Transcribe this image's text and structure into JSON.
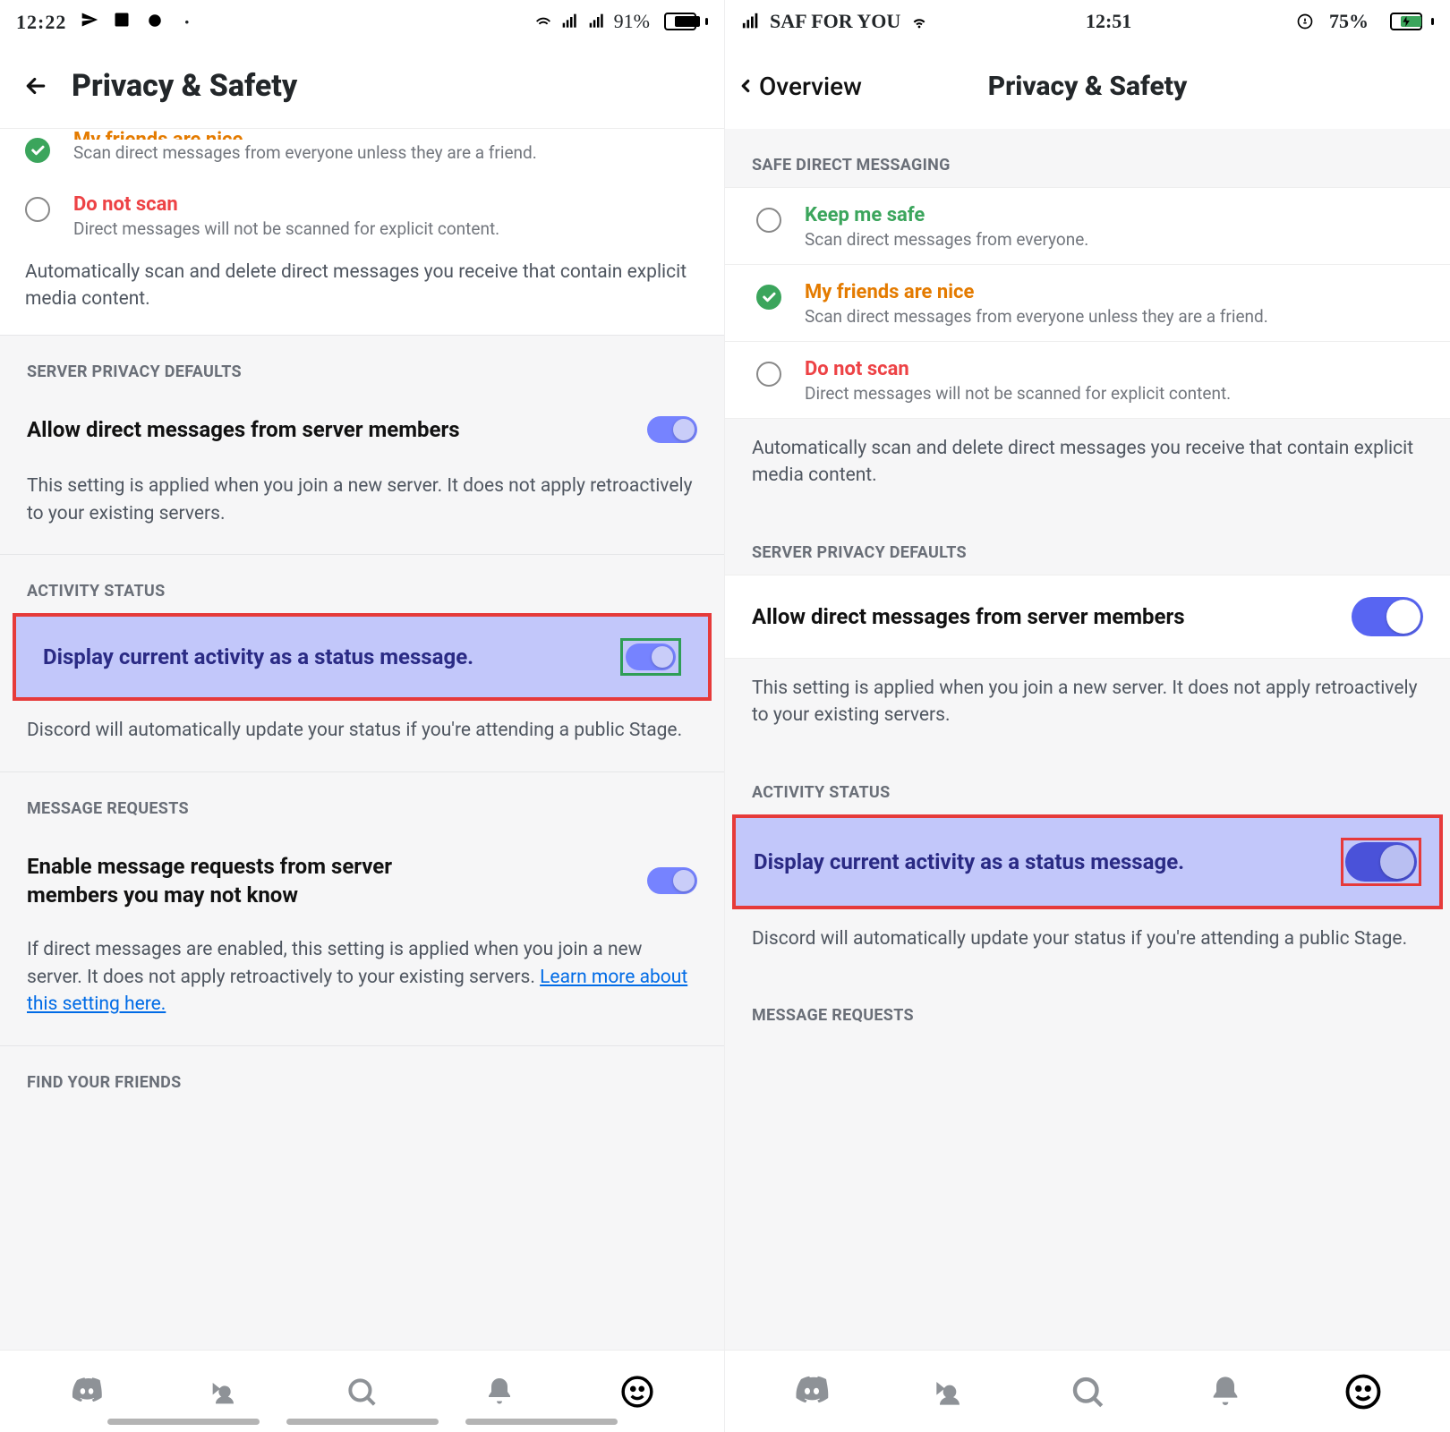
{
  "left": {
    "status": {
      "time": "12:22",
      "battery": "91%"
    },
    "title": "Privacy & Safety",
    "peek_friends": {
      "title": "My friends are nice",
      "sub": "Scan direct messages from everyone unless they are a friend."
    },
    "peek_noscan": {
      "title": "Do not scan",
      "sub": "Direct messages will not be scanned for explicit content."
    },
    "safe_note": "Automatically scan and delete direct messages you receive that contain explicit media content.",
    "server_header": "SERVER PRIVACY DEFAULTS",
    "allow_dm_label": "Allow direct messages from server members",
    "allow_dm_note": "This setting is applied when you join a new server. It does not apply retroactively to your existing servers.",
    "activity_header": "ACTIVITY STATUS",
    "activity_label": "Display current activity as a status message.",
    "activity_note": "Discord will automatically update your status if you're attending a public Stage.",
    "mreq_header": "MESSAGE REQUESTS",
    "mreq_label": "Enable message requests from server members you may not know",
    "mreq_note_1": "If direct messages are enabled, this setting is applied when you join a new server. It does not apply retroactively to your existing servers. ",
    "mreq_link": "Learn more about this setting here.",
    "find_header": "FIND YOUR FRIENDS"
  },
  "right": {
    "status": {
      "carrier": "SAF FOR YOU",
      "time": "12:51",
      "battery": "75%"
    },
    "back": "Overview",
    "title": "Privacy & Safety",
    "safe_header": "SAFE DIRECT MESSAGING",
    "opt_safe": {
      "title": "Keep me safe",
      "sub": "Scan direct messages from everyone."
    },
    "opt_friends": {
      "title": "My friends are nice",
      "sub": "Scan direct messages from everyone unless they are a friend."
    },
    "opt_noscan": {
      "title": "Do not scan",
      "sub": "Direct messages will not be scanned for explicit content."
    },
    "safe_note": "Automatically scan and delete direct messages you receive that contain explicit media content.",
    "server_header": "SERVER PRIVACY DEFAULTS",
    "allow_dm_label": "Allow direct messages from server members",
    "allow_dm_note": "This setting is applied when you join a new server. It does not apply retroactively to your existing servers.",
    "activity_header": "ACTIVITY STATUS",
    "activity_label": "Display current activity as a status message.",
    "activity_note": "Discord will automatically update your status if you're attending a public Stage.",
    "mreq_header": "MESSAGE REQUESTS"
  },
  "icons": {
    "send": "send-icon",
    "image": "image-icon",
    "wifi": "wifi-icon",
    "signal": "signal-icon",
    "battery": "battery-icon",
    "lock": "lock-icon",
    "charge": "charge-icon"
  }
}
